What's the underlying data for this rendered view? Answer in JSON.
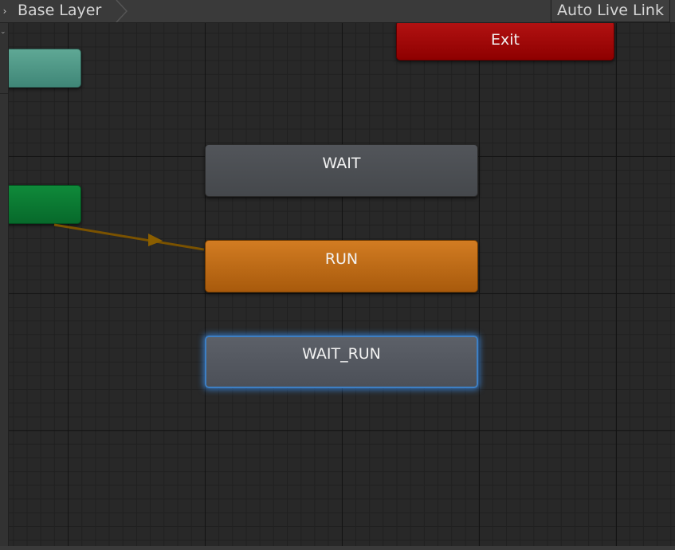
{
  "toolbar": {
    "breadcrumb": "Base Layer",
    "live_link": "Auto Live Link"
  },
  "nodes": {
    "exit": "Exit",
    "wait": "WAIT",
    "run": "RUN",
    "wait_run": "WAIT_RUN",
    "entry": "",
    "any_state": ""
  },
  "colors": {
    "exit": "#a80a0a",
    "state": "#4b4e52",
    "default_state": "#c2701a",
    "selected_outline": "#3d7fc4",
    "entry": "#0a7a32",
    "any_state": "#4f9a88",
    "transition": "#7a5200"
  },
  "icons": [
    "breadcrumb-arrow-icon",
    "breadcrumb-chevron-icon",
    "transition-arrow-icon"
  ]
}
